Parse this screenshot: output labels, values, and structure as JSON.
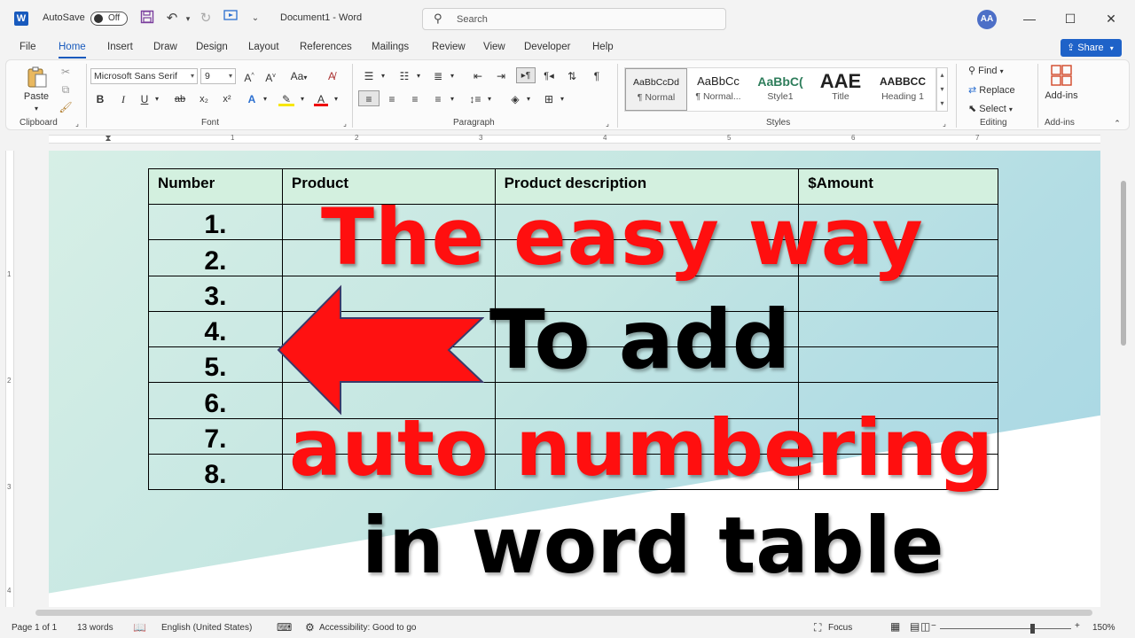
{
  "titlebar": {
    "autosave_label": "AutoSave",
    "autosave_state": "Off",
    "document_title": "Document1 - Word",
    "search_placeholder": "Search",
    "user_initials": "AA",
    "icons": [
      "word-logo",
      "save-icon",
      "undo-icon",
      "redo-icon",
      "present-icon",
      "customize-icon"
    ]
  },
  "tabs": [
    {
      "label": "File"
    },
    {
      "label": "Home",
      "active": true
    },
    {
      "label": "Insert"
    },
    {
      "label": "Draw"
    },
    {
      "label": "Design"
    },
    {
      "label": "Layout"
    },
    {
      "label": "References"
    },
    {
      "label": "Mailings"
    },
    {
      "label": "Review"
    },
    {
      "label": "View"
    },
    {
      "label": "Developer"
    },
    {
      "label": "Help"
    }
  ],
  "share_label": "Share",
  "ribbon": {
    "clipboard": {
      "label": "Clipboard",
      "paste": "Paste"
    },
    "font": {
      "label": "Font",
      "family": "Microsoft Sans Serif",
      "size": "9",
      "bold": "B",
      "italic": "I",
      "underline": "U",
      "strike": "ab",
      "subscript": "x₂",
      "superscript": "x²",
      "case": "Aa"
    },
    "paragraph": {
      "label": "Paragraph"
    },
    "styles": {
      "label": "Styles",
      "items": [
        {
          "preview": "AaBbCcDd",
          "name": "¶ Normal"
        },
        {
          "preview": "AaBbCc",
          "name": "¶ Normal..."
        },
        {
          "preview": "AaBbC(",
          "name": "Style1"
        },
        {
          "preview": "AAE",
          "name": "Title"
        },
        {
          "preview": "AABBCC",
          "name": "Heading 1"
        }
      ]
    },
    "editing": {
      "label": "Editing",
      "find": "Find",
      "replace": "Replace",
      "select": "Select"
    },
    "addins": {
      "label": "Add-ins",
      "button": "Add-ins"
    }
  },
  "ruler": {
    "numbers": [
      "1",
      "2",
      "3",
      "4",
      "5",
      "6",
      "7"
    ],
    "v_numbers": [
      "1",
      "2",
      "3",
      "4"
    ]
  },
  "table": {
    "headers": [
      "Number",
      "Product",
      "Product description",
      "$Amount"
    ],
    "rows": [
      "1.",
      "2.",
      "3.",
      "4.",
      "5.",
      "6.",
      "7.",
      "8."
    ]
  },
  "overlay": {
    "line1": "The easy way",
    "line2": "To add",
    "line3": "auto numbering",
    "line4": "in word table",
    "red": "#ff0f0f",
    "black": "#000000"
  },
  "statusbar": {
    "page": "Page 1 of 1",
    "words": "13 words",
    "language": "English (United States)",
    "accessibility": "Accessibility: Good to go",
    "focus": "Focus",
    "zoom": "150%"
  },
  "colors": {
    "accent": "#185abd",
    "share": "#1e62c8"
  }
}
